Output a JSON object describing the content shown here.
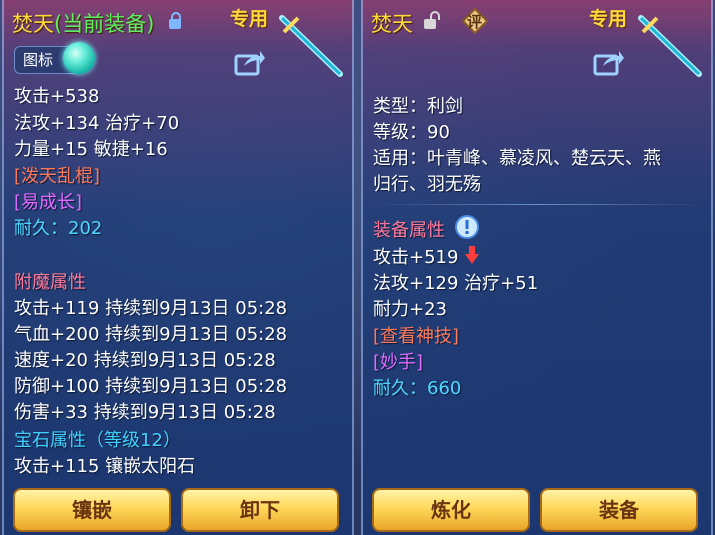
{
  "left": {
    "title": "焚天",
    "title_suffix": "(当前装备)",
    "exclusive": "专用",
    "icon_chip": "图标",
    "stats": [
      "攻击+538",
      "法攻+134 治疗+70",
      "力量+15 敏捷+16"
    ],
    "skill_1": "[泼天乱棍]",
    "skill_2": "[易成长]",
    "durability": "耐久：202",
    "enchant_header": "附魔属性",
    "enchant": [
      "攻击+119 持续到9月13日 05:28",
      "气血+200 持续到9月13日 05:28",
      "速度+20 持续到9月13日 05:28",
      "防御+100 持续到9月13日 05:28",
      "伤害+33 持续到9月13日 05:28"
    ],
    "gem_header": "宝石属性（等级12）",
    "gem": "攻击+115 镶嵌太阳石",
    "buttons": {
      "inlay": "镶嵌",
      "unequip": "卸下"
    }
  },
  "right": {
    "title": "焚天",
    "review_badge": "评",
    "exclusive": "专用",
    "type": "类型：利剑",
    "level": "等级：90",
    "applicable_1": "适用：叶青峰、慕凌风、楚云天、燕",
    "applicable_2": "归行、羽无殇",
    "attr_header": "装备属性",
    "attack": "攻击+519",
    "stats": [
      "法攻+129 治疗+51",
      "耐力+23"
    ],
    "skill_1": "[查看神技]",
    "skill_2": "[妙手]",
    "durability": "耐久：660",
    "buttons": {
      "refine": "炼化",
      "equip": "装备"
    }
  },
  "colors": {
    "gold": "#ffd83a",
    "green": "#5cf25c",
    "orange": "#ff7a5a",
    "purple": "#e06bff",
    "cyan": "#4fd8ff"
  }
}
